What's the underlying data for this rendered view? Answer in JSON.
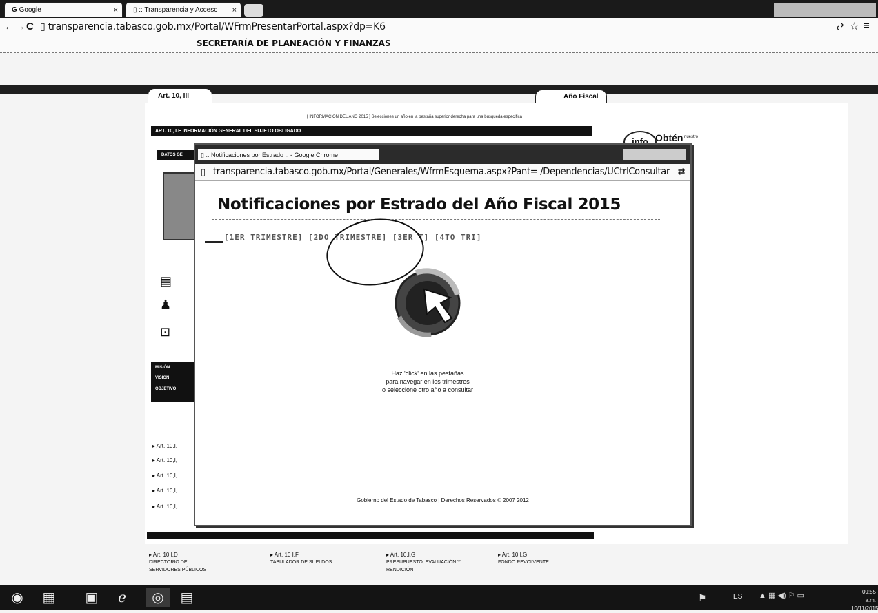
{
  "browser": {
    "tabs": [
      {
        "label": "Google",
        "close": "×"
      },
      {
        "label": ":: Transparencia y Accesc",
        "close": "×"
      }
    ],
    "url": "transparencia.tabasco.gob.mx/Portal/WFrmPresentarPortal.aspx?dp=K6"
  },
  "page": {
    "header": "SECRETARÍA DE PLANEACIÓN Y FINANZAS",
    "art_tab": "Art. 10, III",
    "anio_tab": "Año Fiscal",
    "info_line": "[ INFORMACIÓN DEL AÑO 2015 ]  Selecciones un año en la pestaña superior derecha para una busqueda especifica",
    "section_title": "ART. 10, I.E INFORMACIÓN GENERAL DEL SUJETO OBLIGADO",
    "datos_label": "DATOS GE",
    "mission_items": [
      "MISIÓN",
      "VISIÓN",
      "OBJETIVO"
    ],
    "art_links": [
      "▸ Art. 10,I,",
      "▸ Art. 10,I,",
      "▸ Art. 10,I,",
      "▸ Art. 10,I,",
      "▸ Art. 10,I,"
    ],
    "bottom_links": [
      {
        "art": "▸ Art. 10,I,D",
        "desc": "DIRECTORIO DE SERVIDORES PÚBLICOS"
      },
      {
        "art": "▸ Art. 10 I,F",
        "desc": "TABULADOR DE SUELDOS"
      },
      {
        "art": "▸ Art. 10,I,G",
        "desc": "PRESUPUESTO, EVALUACIÓN Y RENDICIÓN"
      },
      {
        "art": "▸ Art. 10,I,G",
        "desc": "FONDO REVOLVENTE"
      }
    ],
    "info_badge": "info",
    "obten": "Obtén",
    "obten_sub": "nuestro"
  },
  "popup": {
    "title": ":: Notificaciones por Estrado :: - Google Chrome",
    "url": "transparencia.tabasco.gob.mx/Portal/Generales/WfrmEsquema.aspx?Pant= /Dependencias/UCtrlConsultar",
    "heading": "Notificaciones por Estrado del Año Fiscal 2015",
    "tabs_row": "[1ER TRIMESTRE] [2DO TRIMESTRE] [3ER T] [4TO TRI]",
    "instructions": [
      "Haz 'click' en las pestañas",
      "para navegar en los trimestres",
      "o seleccione otro año a consultar"
    ],
    "footer": "Gobierno del Estado de Tabasco | Derechos Reservados © 2007 2012"
  },
  "taskbar": {
    "lang": "ES",
    "time": "09:55 a.m.",
    "date": "10/11/2015"
  },
  "colors": {
    "dark": "#1a1a1a",
    "page": "#ffffff",
    "accent": "#2b2b2b"
  }
}
